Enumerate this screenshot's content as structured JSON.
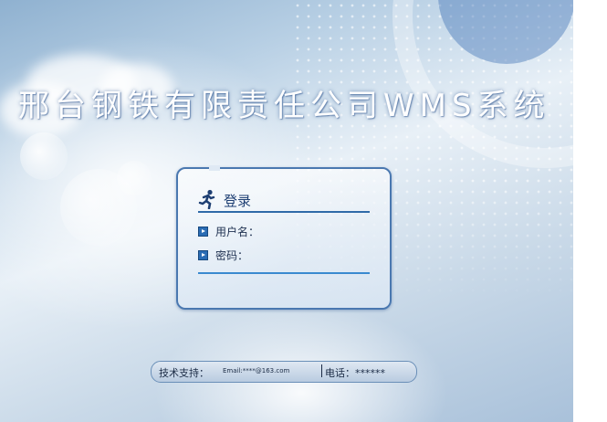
{
  "app": {
    "title": "邢台钢铁有限责任公司WMS系统"
  },
  "login_panel": {
    "header": "登录",
    "username_label": "用户名：",
    "password_label": "密码："
  },
  "footer": {
    "support_label": "技术支持：",
    "email": "Email:****@163.com",
    "phone": "电话：******"
  },
  "colors": {
    "panel_border": "#4a78b0",
    "accent_blue": "#2f6aa8"
  }
}
